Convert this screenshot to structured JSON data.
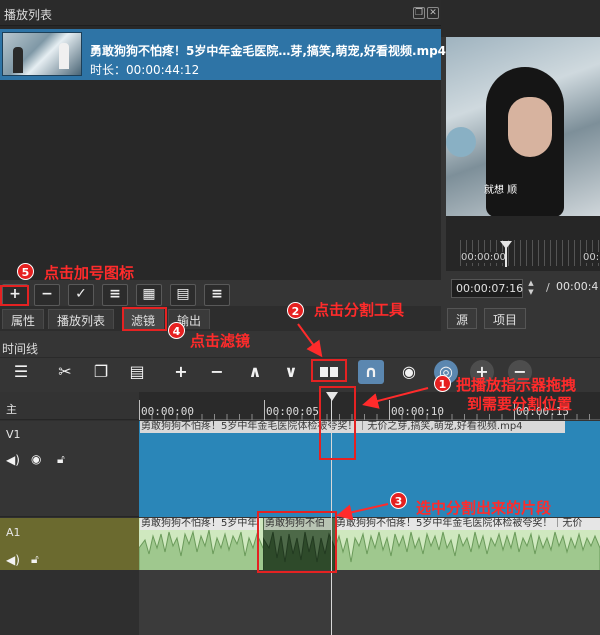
{
  "playlist": {
    "title": "播放列表",
    "item": {
      "title": "勇敢狗狗不怕疼！5岁中年金毛医院…芽,搞笑,萌宠,好看视频.mp4",
      "duration": "时长：00:00:44:12"
    },
    "toolbar": [
      "+",
      "−",
      "✓",
      "≡",
      "▦",
      "▤",
      "≡"
    ],
    "tabs": [
      "属性",
      "播放列表",
      "滤镜",
      "输出"
    ]
  },
  "preview": {
    "caption": "就想 顺",
    "scrub_start": "00:00:00",
    "scrub_end": "00:",
    "current_time": "00:00:07:16",
    "total_time": "00:00:4",
    "tabs": [
      "源",
      "项目"
    ]
  },
  "timeline": {
    "title": "时间线",
    "ruler": [
      "00:00:00",
      "00:00:05",
      "00:00:10",
      "00:00:15"
    ],
    "tracks": {
      "main": "主",
      "v1": "V1",
      "a1": "A1"
    },
    "v1_clip_name": "勇敢狗狗不怕疼！5岁中年金毛医院体检被夸奖！｜无价之芽,搞笑,萌宠,好看视频.mp4",
    "a1_clip_name_a": "勇敢狗狗不怕疼！5岁中年",
    "a1_clip_name_b": "勇敢狗狗不伯",
    "a1_clip_name_c": "勇敢狗狗不怕疼！5岁中年金毛医院体检被夸奖！｜无价"
  },
  "annotations": {
    "n1": "1",
    "n1_text_a": "把播放指示器拖拽",
    "n1_text_b": "到需要分割位置",
    "n2": "2",
    "n2_text": "点击分割工具",
    "n3": "3",
    "n3_text": "选中分割出来的片段",
    "n4": "4",
    "n4_text": "点击滤镜",
    "n5": "5",
    "n5_text": "点击加号图标"
  },
  "colors": {
    "accent": "#2e74a6",
    "v1_clip": "#2a86b8",
    "a1_track": "#6b6a2f",
    "annotation": "#ff2b2b"
  }
}
